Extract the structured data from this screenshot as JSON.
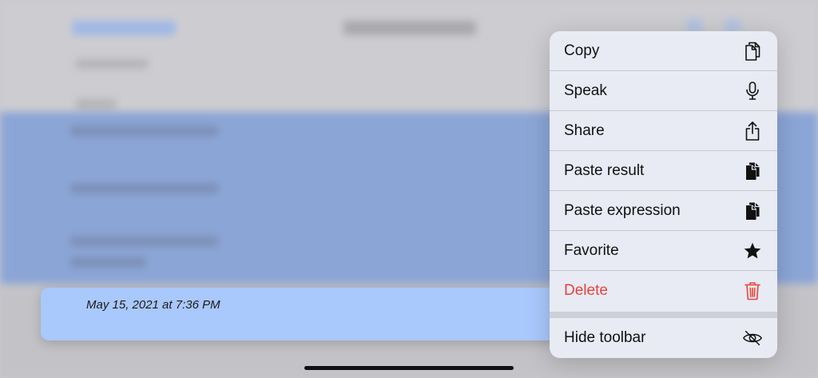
{
  "history": {
    "selected_timestamp": "May 15, 2021 at 7:36 PM"
  },
  "context_menu": {
    "items": [
      {
        "label": "Copy",
        "icon": "copy-icon"
      },
      {
        "label": "Speak",
        "icon": "microphone-icon"
      },
      {
        "label": "Share",
        "icon": "share-icon"
      },
      {
        "label": "Paste result",
        "icon": "paste-icon"
      },
      {
        "label": "Paste expression",
        "icon": "paste-icon"
      },
      {
        "label": "Favorite",
        "icon": "star-icon"
      },
      {
        "label": "Delete",
        "icon": "trash-icon",
        "destructive": true
      }
    ],
    "footer_item": {
      "label": "Hide toolbar",
      "icon": "eye-slash-icon"
    }
  },
  "colors": {
    "menu_background": "#e8ebf4",
    "destructive": "#e8443a",
    "selected_cell": "#a9c8fb",
    "background_highlight": "#8ba5d6"
  }
}
